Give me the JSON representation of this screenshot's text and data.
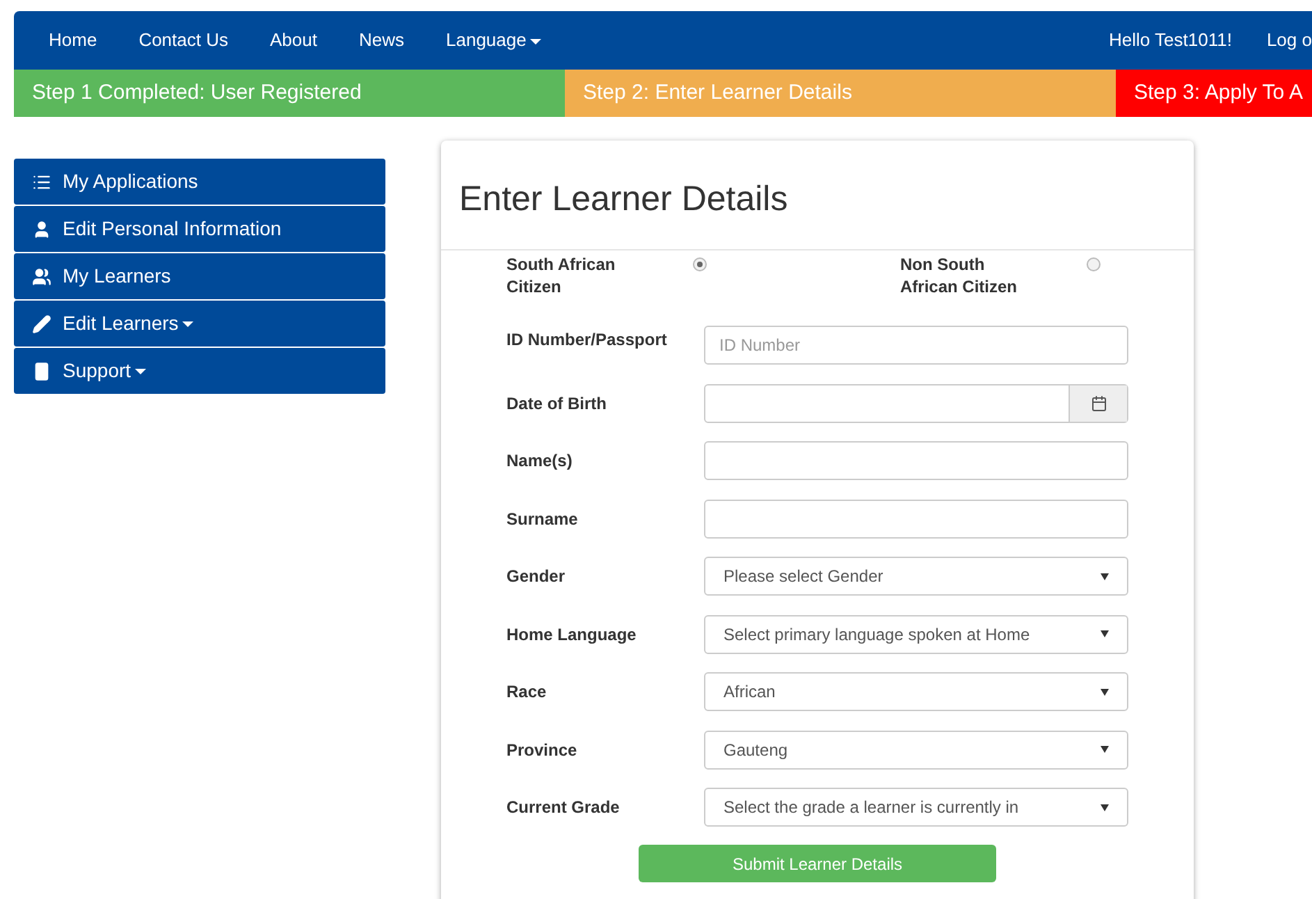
{
  "navbar": {
    "left_items": [
      {
        "label": "Home",
        "dropdown": false
      },
      {
        "label": "Contact Us",
        "dropdown": false
      },
      {
        "label": "About",
        "dropdown": false
      },
      {
        "label": "News",
        "dropdown": false
      },
      {
        "label": "Language",
        "dropdown": true
      }
    ],
    "greeting": "Hello Test1011!",
    "logout": "Log o"
  },
  "steps": [
    {
      "label": "Step 1 Completed: User Registered",
      "color": "#5cb85c"
    },
    {
      "label": "Step 2: Enter Learner Details",
      "color": "#f0ad4e"
    },
    {
      "label": "Step 3: Apply To A",
      "color": "#ff0000"
    }
  ],
  "sidebar": {
    "items": [
      {
        "label": "My Applications",
        "dropdown": false
      },
      {
        "label": "Edit Personal Information",
        "dropdown": false
      },
      {
        "label": "My Learners",
        "dropdown": false
      },
      {
        "label": "Edit Learners",
        "dropdown": true
      },
      {
        "label": "Support",
        "dropdown": true
      }
    ]
  },
  "form": {
    "title": "Enter Learner Details",
    "citizenship": [
      {
        "label": "South African Citizen",
        "selected": true
      },
      {
        "label": "Non South African Citizen",
        "selected": false
      }
    ],
    "fields": [
      {
        "kind": "text",
        "label": "ID Number/Passport",
        "placeholder": "ID Number"
      },
      {
        "kind": "date",
        "label": "Date of Birth"
      },
      {
        "kind": "text",
        "label": "Name(s)"
      },
      {
        "kind": "text",
        "label": "Surname"
      },
      {
        "kind": "select",
        "label": "Gender",
        "value": "Please select Gender"
      },
      {
        "kind": "select",
        "label": "Home Language",
        "value": "Select primary language spoken at Home"
      },
      {
        "kind": "select",
        "label": "Race",
        "value": "African"
      },
      {
        "kind": "select",
        "label": "Province",
        "value": "Gauteng"
      },
      {
        "kind": "select",
        "label": "Current Grade",
        "value": "Select the grade a learner is currently in"
      }
    ],
    "submit": "Submit Learner Details"
  }
}
